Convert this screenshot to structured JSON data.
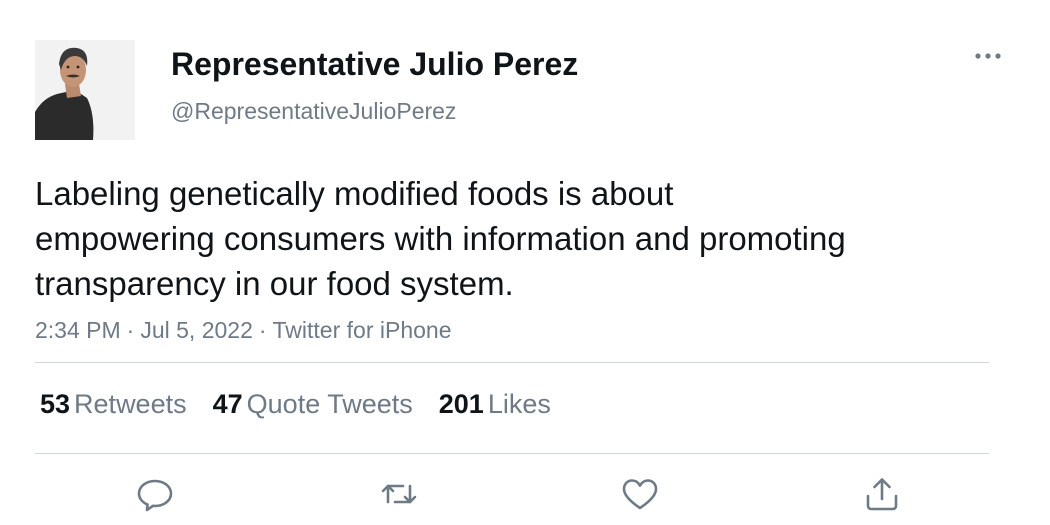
{
  "author": {
    "display_name": "Representative Julio Perez",
    "handle": "@RepresentativeJulioPerez"
  },
  "tweet": {
    "text_lines": [
      "Labeling genetically modified foods is about",
      "empowering consumers with information and promoting",
      "transparency in our food system."
    ],
    "time": "2:34 PM",
    "date": "Jul 5, 2022",
    "source": "Twitter for iPhone",
    "separator": "·"
  },
  "stats": {
    "retweets": {
      "count": "53",
      "label": "Retweets"
    },
    "quotes": {
      "count": "47",
      "label": "Quote Tweets"
    },
    "likes": {
      "count": "201",
      "label": "Likes"
    }
  },
  "icons": {
    "more": "more-horizontal-icon",
    "reply": "reply-icon",
    "retweet": "retweet-icon",
    "like": "heart-icon",
    "share": "share-icon"
  },
  "colors": {
    "text_primary": "#0f1419",
    "text_secondary": "#6e7a86",
    "divider": "#cfd9de"
  }
}
